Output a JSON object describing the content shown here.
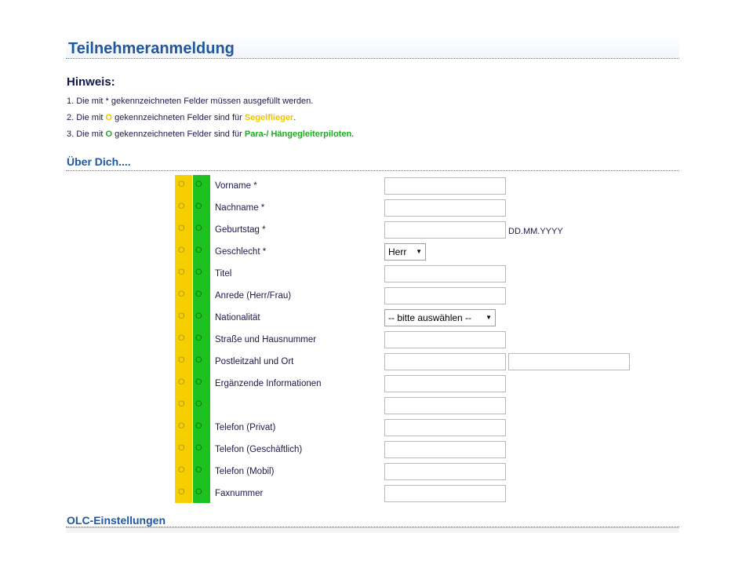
{
  "page": {
    "title": "Teilnehmeranmeldung"
  },
  "hints": {
    "heading": "Hinweis:",
    "line1": "1. Die mit  * gekennzeichneten Felder müssen ausgefüllt werden.",
    "line2_pre": "2. Die mit ",
    "line2_marker": "O",
    "line2_mid": " gekennzeichneten Felder sind für ",
    "line2_highlight": "Segelflieger",
    "line2_post": ".",
    "line3_pre": "3. Die mit ",
    "line3_marker": "O",
    "line3_mid": " gekennzeichneten Felder sind für ",
    "line3_highlight": "Para-/ Hängegleiterpiloten",
    "line3_post": "."
  },
  "colors": {
    "segelflieger": "#f5cf00",
    "paraglider": "#1ec21e",
    "heading_blue": "#1f57a0"
  },
  "sections": {
    "about": "Über Dich....",
    "olc": "OLC-Einstellungen"
  },
  "form": {
    "marker": "O",
    "vorname_label": "Vorname *",
    "vorname_value": "",
    "nachname_label": "Nachname *",
    "nachname_value": "",
    "geburtstag_label": "Geburtstag *",
    "geburtstag_value": "",
    "geburtstag_format": "DD.MM.YYYY",
    "geschlecht_label": "Geschlecht *",
    "geschlecht_selected": "Herr",
    "titel_label": "Titel",
    "titel_value": "",
    "anrede_label": "Anrede (Herr/Frau)",
    "anrede_value": "",
    "nationalitaet_label": "Nationalität",
    "nationalitaet_selected": "-- bitte auswählen --",
    "strasse_label": "Straße und Hausnummer",
    "strasse_value": "",
    "plz_ort_label": "Postleitzahl und Ort",
    "plz_value": "",
    "ort_value": "",
    "ergaenzend_label": "Ergänzende Informationen",
    "ergaenzend1_value": "",
    "ergaenzend2_value": "",
    "tel_privat_label": "Telefon (Privat)",
    "tel_privat_value": "",
    "tel_geschaeft_label": "Telefon (Geschäftlich)",
    "tel_geschaeft_value": "",
    "tel_mobil_label": "Telefon (Mobil)",
    "tel_mobil_value": "",
    "fax_label": "Faxnummer",
    "fax_value": ""
  }
}
